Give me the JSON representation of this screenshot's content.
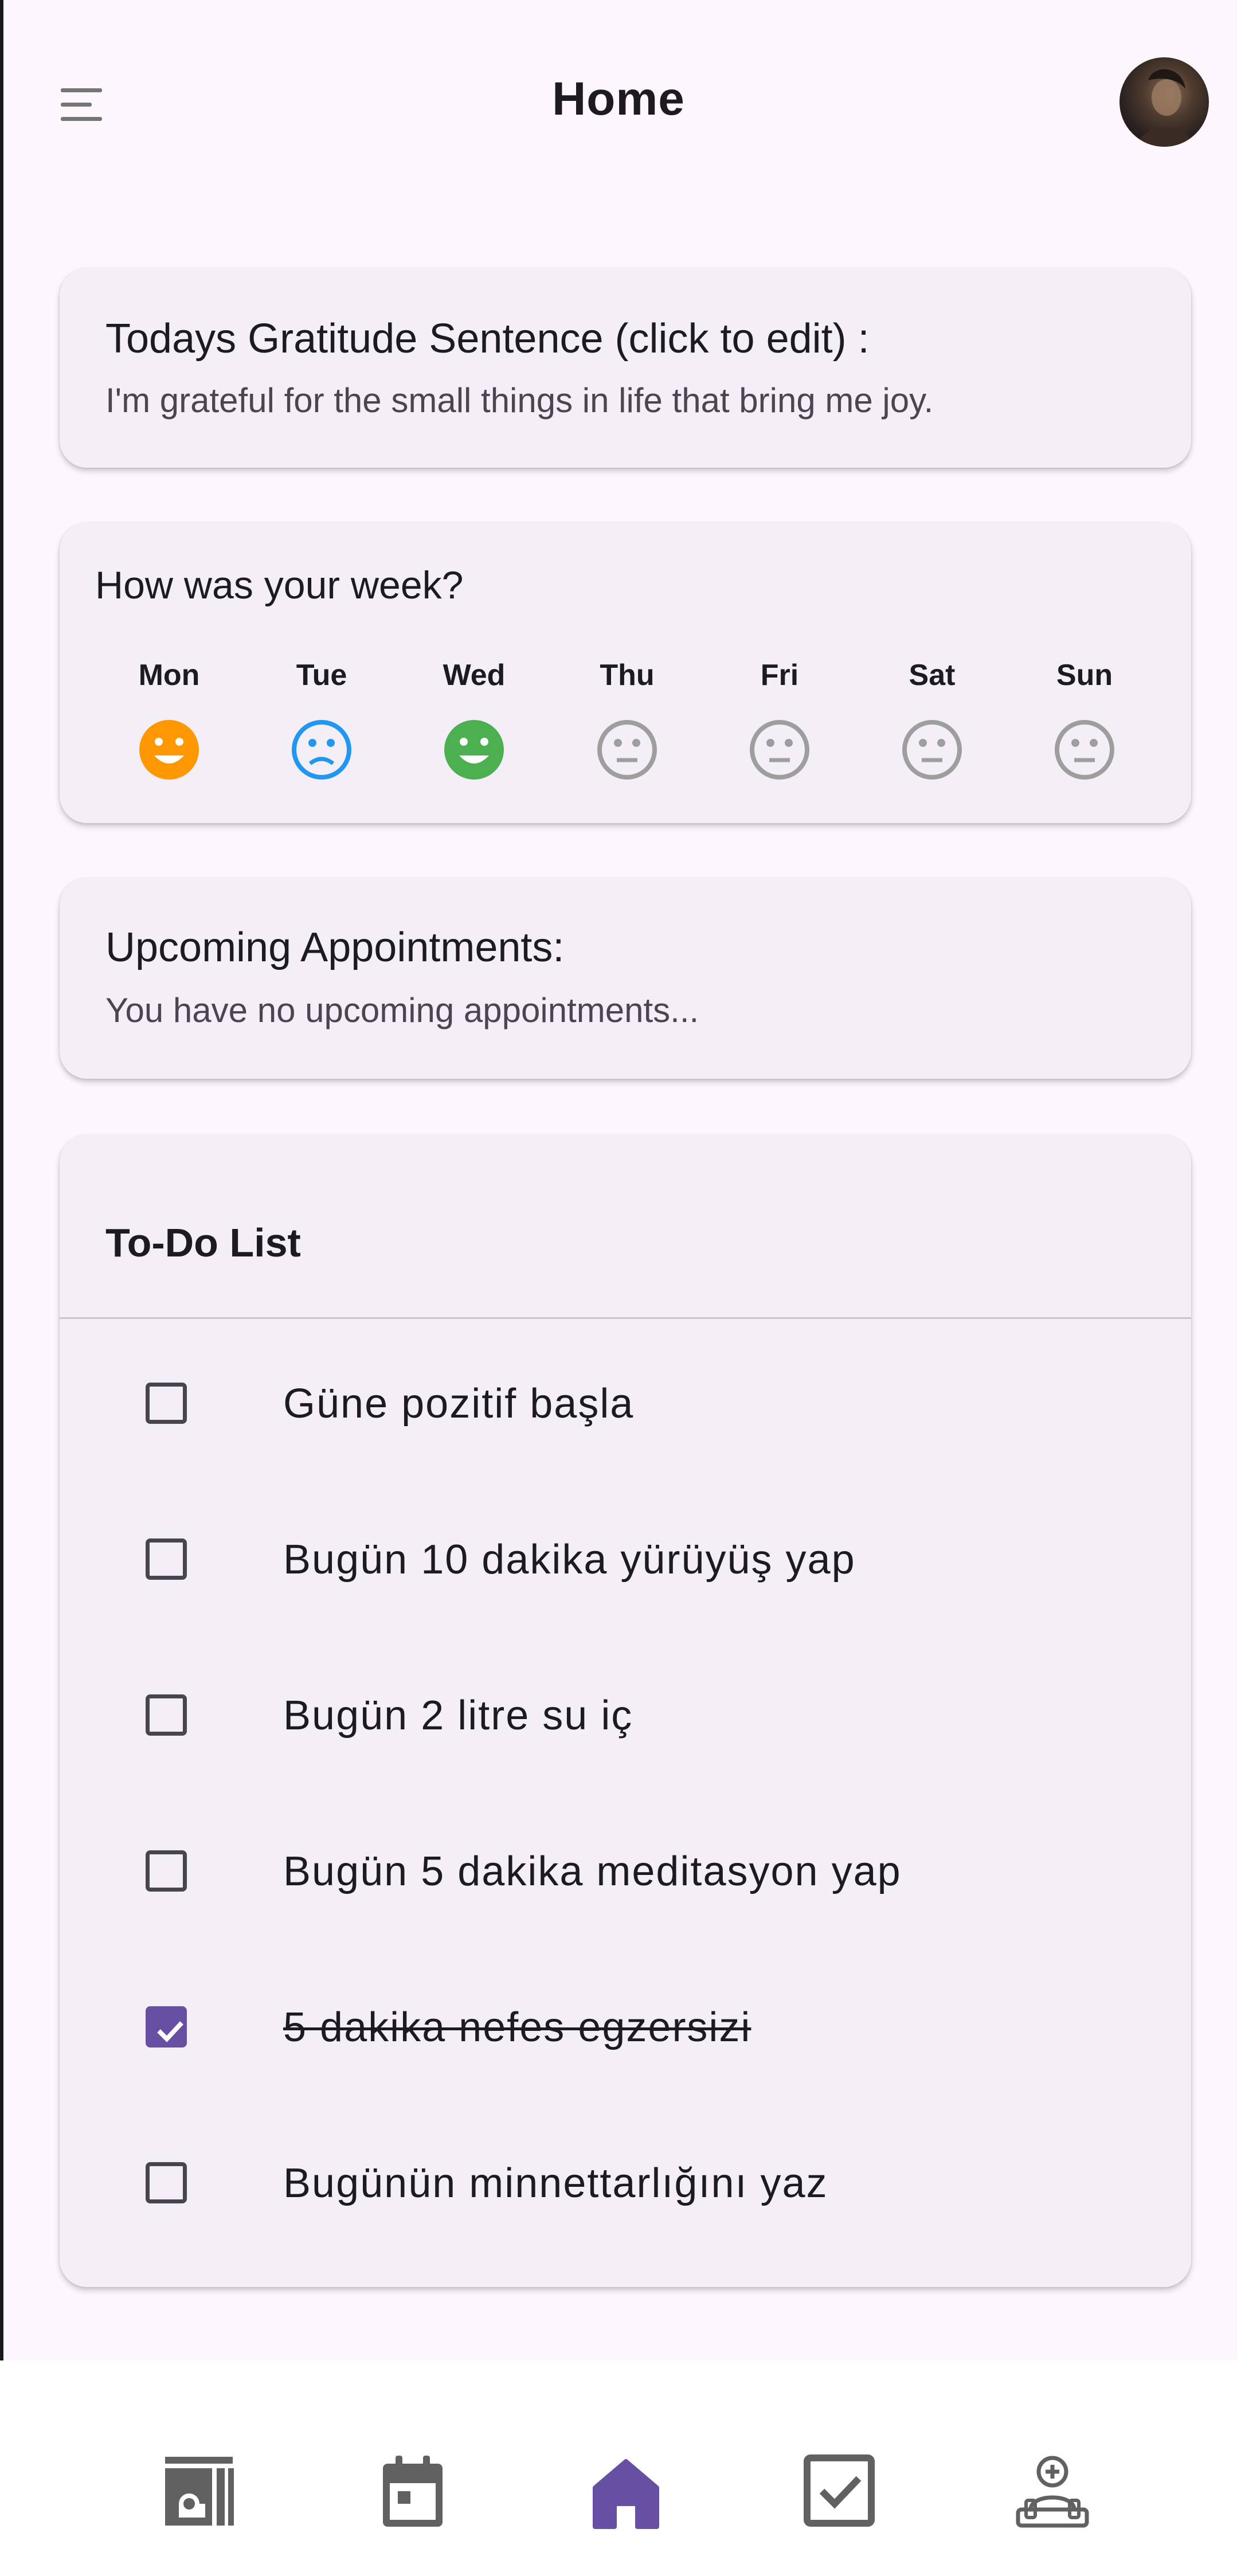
{
  "colors": {
    "primary": "#6750a4",
    "mood_mon": "#ff9800",
    "mood_tue": "#2196f3",
    "mood_wed": "#4caf50",
    "mood_empty": "#9e9e9e"
  },
  "appbar": {
    "title": "Home",
    "menu_icon": "menu-icon",
    "avatar": "profile-avatar"
  },
  "gratitude": {
    "title": "Todays Gratitude Sentence (click to edit) :",
    "sentence": "I'm grateful for the small things in life that bring me joy."
  },
  "week": {
    "title": "How was your week?",
    "days": [
      {
        "label": "Mon",
        "mood": "happy",
        "color": "#ff9800"
      },
      {
        "label": "Tue",
        "mood": "sad",
        "color": "#2196f3"
      },
      {
        "label": "Wed",
        "mood": "happy",
        "color": "#4caf50"
      },
      {
        "label": "Thu",
        "mood": "neutral",
        "color": "#9e9e9e"
      },
      {
        "label": "Fri",
        "mood": "neutral",
        "color": "#9e9e9e"
      },
      {
        "label": "Sat",
        "mood": "neutral",
        "color": "#9e9e9e"
      },
      {
        "label": "Sun",
        "mood": "neutral",
        "color": "#9e9e9e"
      }
    ]
  },
  "appointments": {
    "title": "Upcoming Appointments:",
    "message": "You have no upcoming appointments..."
  },
  "todo": {
    "title": "To-Do List",
    "items": [
      {
        "label": "Güne pozitif başla",
        "checked": false
      },
      {
        "label": "Bugün 10 dakika yürüyüş yap",
        "checked": false
      },
      {
        "label": "Bugün 2 litre su iç",
        "checked": false
      },
      {
        "label": "Bugün 5 dakika meditasyon yap",
        "checked": false
      },
      {
        "label": "5 dakika nefes egzersizi",
        "checked": true
      },
      {
        "label": "Bugünün minnettarlığını yaz",
        "checked": false
      }
    ]
  },
  "bottom_nav": {
    "items": [
      "journal-icon",
      "calendar-icon",
      "home-icon",
      "checklist-icon",
      "therapist-icon"
    ],
    "active": "home-icon"
  }
}
